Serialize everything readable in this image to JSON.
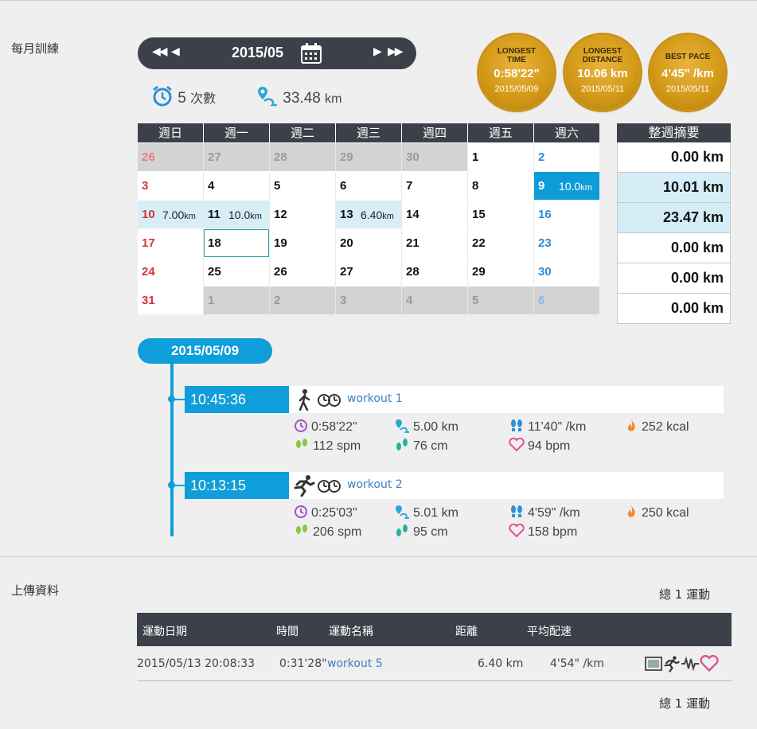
{
  "sections": {
    "monthly_training": "每月訓練",
    "upload_data": "上傳資料"
  },
  "month_nav": {
    "prev_year": "◀◀",
    "prev_month": "◀",
    "title": "2015/05",
    "next_month": "▶",
    "next_year": "▶▶"
  },
  "summary": {
    "sessions_value": "5",
    "sessions_unit": "次數",
    "distance_value": "33.48",
    "distance_unit": "km"
  },
  "medals": [
    {
      "label": "LONGEST TIME",
      "value": "0:58'22\"",
      "date": "2015/05/09"
    },
    {
      "label": "LONGEST DISTANCE",
      "value": "10.06 km",
      "date": "2015/05/11"
    },
    {
      "label": "BEST PACE",
      "value": "4'45\" /km",
      "date": "2015/05/11"
    }
  ],
  "calendar": {
    "weekdays": [
      "週日",
      "週一",
      "週二",
      "週三",
      "週四",
      "週五",
      "週六"
    ],
    "weeks": [
      [
        {
          "d": "26",
          "o": true
        },
        {
          "d": "27",
          "o": true
        },
        {
          "d": "28",
          "o": true
        },
        {
          "d": "29",
          "o": true
        },
        {
          "d": "30",
          "o": true
        },
        {
          "d": "1"
        },
        {
          "d": "2"
        }
      ],
      [
        {
          "d": "3"
        },
        {
          "d": "4"
        },
        {
          "d": "5"
        },
        {
          "d": "6"
        },
        {
          "d": "7"
        },
        {
          "d": "8"
        },
        {
          "d": "9",
          "dist": "10.0",
          "unit": "km",
          "state": "sel"
        }
      ],
      [
        {
          "d": "10",
          "dist": "7.00",
          "unit": "km",
          "state": "light"
        },
        {
          "d": "11",
          "dist": "10.0",
          "unit": "km",
          "state": "light"
        },
        {
          "d": "12"
        },
        {
          "d": "13",
          "dist": "6.40",
          "unit": "km",
          "state": "light"
        },
        {
          "d": "14"
        },
        {
          "d": "15"
        },
        {
          "d": "16"
        }
      ],
      [
        {
          "d": "17"
        },
        {
          "d": "18",
          "state": "today"
        },
        {
          "d": "19"
        },
        {
          "d": "20"
        },
        {
          "d": "21"
        },
        {
          "d": "22"
        },
        {
          "d": "23"
        }
      ],
      [
        {
          "d": "24"
        },
        {
          "d": "25"
        },
        {
          "d": "26"
        },
        {
          "d": "27"
        },
        {
          "d": "28"
        },
        {
          "d": "29"
        },
        {
          "d": "30"
        }
      ],
      [
        {
          "d": "31"
        },
        {
          "d": "1",
          "o": true
        },
        {
          "d": "2",
          "o": true
        },
        {
          "d": "3",
          "o": true
        },
        {
          "d": "4",
          "o": true
        },
        {
          "d": "5",
          "o": true
        },
        {
          "d": "6",
          "o": true
        }
      ]
    ]
  },
  "weekly_summary": {
    "title": "整週摘要",
    "rows": [
      {
        "value": "0.00 km",
        "hl": false
      },
      {
        "value": "10.01 km",
        "hl": true
      },
      {
        "value": "23.47 km",
        "hl": true
      },
      {
        "value": "0.00 km",
        "hl": false
      },
      {
        "value": "0.00 km",
        "hl": false
      },
      {
        "value": "0.00 km",
        "hl": false
      }
    ]
  },
  "day": {
    "date": "2015/05/09",
    "workouts": [
      {
        "time": "10:45:36",
        "mode": "walk",
        "name": "workout 1",
        "duration": "0:58'22\"",
        "distance": "5.00 km",
        "pace": "11'40\" /km",
        "calories": "252 kcal",
        "cadence": "112 spm",
        "stride": "76 cm",
        "heart_rate": "94 bpm"
      },
      {
        "time": "10:13:15",
        "mode": "run",
        "name": "workout 2",
        "duration": "0:25'03\"",
        "distance": "5.01 km",
        "pace": "4'59\" /km",
        "calories": "250 kcal",
        "cadence": "206 spm",
        "stride": "95 cm",
        "heart_rate": "158 bpm"
      }
    ]
  },
  "uploads": {
    "total_top": "總 1 運動",
    "total_bottom": "總 1 運動",
    "columns": {
      "date": "運動日期",
      "time": "時間",
      "name": "運動名稱",
      "distance": "距離",
      "pace": "平均配速"
    },
    "rows": [
      {
        "date": "2015/05/13 20:08:33",
        "time": "0:31'28\"",
        "name": "workout 5",
        "distance": "6.40 km",
        "pace": "4'54\" /km"
      }
    ]
  },
  "colors": {
    "dark": "#3c4049",
    "accent": "#0f9ed9",
    "gold": "#d49a18",
    "sunday": "#d8323a",
    "saturday": "#2e8cd6"
  }
}
